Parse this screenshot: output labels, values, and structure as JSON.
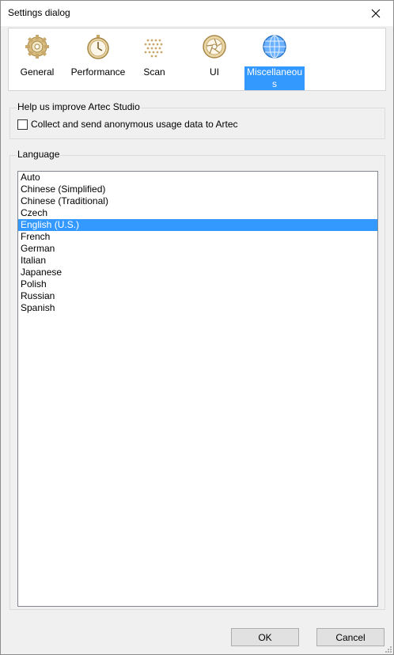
{
  "window": {
    "title": "Settings dialog"
  },
  "toolbar": {
    "items": [
      {
        "label": "General",
        "icon": "gear-icon"
      },
      {
        "label": "Performance",
        "icon": "stopwatch-icon"
      },
      {
        "label": "Scan",
        "icon": "dots-grid-icon"
      },
      {
        "label": "UI",
        "icon": "aperture-icon"
      },
      {
        "label": "Miscellaneous",
        "label_line1": "Miscellaneou",
        "label_line2": "s",
        "icon": "globe-icon",
        "selected": true
      }
    ]
  },
  "help": {
    "title": "Help us improve Artec Studio",
    "checkbox_label": "Collect and send anonymous usage data to Artec",
    "checked": false
  },
  "language": {
    "title": "Language",
    "options": [
      "Auto",
      "Chinese (Simplified)",
      "Chinese (Traditional)",
      "Czech",
      "English (U.S.)",
      "French",
      "German",
      "Italian",
      "Japanese",
      "Polish",
      "Russian",
      "Spanish"
    ],
    "selected": "English (U.S.)"
  },
  "buttons": {
    "ok": "OK",
    "cancel": "Cancel"
  },
  "colors": {
    "selection": "#3399ff",
    "window_bg": "#f0f0f0",
    "icon_gold": "#c8a86a"
  }
}
